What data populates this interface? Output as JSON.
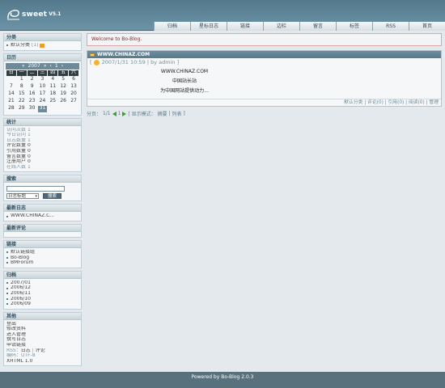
{
  "logo": {
    "text": "sweet",
    "version": "V5.1"
  },
  "nav": [
    "归档",
    "星标日志",
    "链接",
    "边栏",
    "留言",
    "标签",
    "RSS",
    "首页"
  ],
  "sidebar": {
    "categories": {
      "title": "分类",
      "items": [
        {
          "label": "默认分类",
          "count": "[1]"
        }
      ]
    },
    "calendar": {
      "title": "日历",
      "prev": "«",
      "year": "2007",
      "next": "»",
      "prev_month": "‹",
      "month": "1",
      "next_month": "›",
      "weekdays": [
        "日",
        "一",
        "二",
        "三",
        "四",
        "五",
        "六"
      ],
      "weeks": [
        [
          "",
          "1",
          "2",
          "3",
          "4",
          "5",
          "6"
        ],
        [
          "7",
          "8",
          "9",
          "10",
          "11",
          "12",
          "13"
        ],
        [
          "14",
          "15",
          "16",
          "17",
          "18",
          "19",
          "20"
        ],
        [
          "21",
          "22",
          "23",
          "24",
          "25",
          "26",
          "27"
        ],
        [
          "28",
          "29",
          "30",
          "31",
          "",
          "",
          ""
        ]
      ],
      "today": "31"
    },
    "stats": {
      "title": "统计",
      "items": [
        {
          "label": "访问次数",
          "value": "1",
          "muted": true
        },
        {
          "label": "今日访问",
          "value": "1",
          "muted": true
        },
        {
          "label": "日志数量",
          "value": "1",
          "muted": true
        },
        {
          "label": "评论数量",
          "value": "0",
          "muted": false
        },
        {
          "label": "引用数量",
          "value": "0",
          "muted": false
        },
        {
          "label": "留言数量",
          "value": "0",
          "muted": false
        },
        {
          "label": "注册用户",
          "value": "0",
          "muted": false
        },
        {
          "label": "在线人数",
          "value": "1",
          "muted": true
        }
      ]
    },
    "search": {
      "title": "搜索",
      "placeholder": "",
      "select_value": "日志标题",
      "button": "搜索"
    },
    "recent": {
      "title": "最新日志",
      "items": [
        "WWW.CHINAZ.C..."
      ]
    },
    "comments": {
      "title": "最新评论"
    },
    "links": {
      "title": "链接",
      "items": [
        "默认链接组",
        "Bo-Blog",
        "BMForum"
      ]
    },
    "archive": {
      "title": "归档",
      "items": [
        "2007/01",
        "2006/12",
        "2006/11",
        "2006/10",
        "2006/09"
      ]
    },
    "other": {
      "title": "其他",
      "items": [
        "登出",
        "修改资料",
        "进入管理",
        "撰写日志",
        "申请链接"
      ],
      "rss_label": "RSS：",
      "rss_log": "日志",
      "rss_sep": "|",
      "rss_comment": "评论",
      "encoding_label": "编码：",
      "encoding": "UTF-8",
      "xhtml": "XHTML 1.0"
    }
  },
  "main": {
    "welcome": "Welcome to Bo-Blog.",
    "post": {
      "title": "WWW.CHINAZ.COM",
      "date": "2007/1/31 10:59",
      "by": "by",
      "author": "admin",
      "body": [
        "WWW.CHINAZ.COM",
        "中国站长站",
        "为中国网站提供动力..."
      ],
      "footer": {
        "category": "默认分类",
        "comments": "评论(0)",
        "trackbacks": "引用(0)",
        "reads": "阅读(0)",
        "admin": "管理"
      }
    },
    "pager": {
      "label": "分页：",
      "pages": "1/1",
      "current": "1",
      "mode_label": "[ 显示模式：",
      "summary": "摘要",
      "sep": "|",
      "list": "列表",
      "close": "]"
    }
  },
  "footer": {
    "text": "Powered by Bo-Blog 2.0.3"
  }
}
